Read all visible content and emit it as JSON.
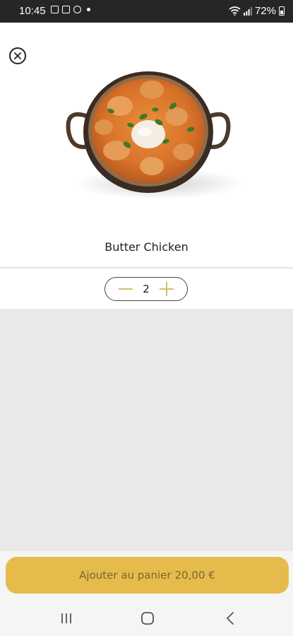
{
  "status_bar": {
    "time": "10:45",
    "battery": "72%"
  },
  "product": {
    "name": "Butter Chicken"
  },
  "quantity": {
    "value": "2"
  },
  "cart_button": {
    "label": "Ajouter au panier",
    "price": "20,00 €"
  },
  "colors": {
    "accent": "#e5bc4c",
    "accent_text": "#7a6530",
    "stepper_sign": "#d8bc73",
    "status_bar": "#262626",
    "empty_area": "#e9e9e9"
  },
  "icons": {
    "close": "close-icon",
    "minus": "minus-icon",
    "plus": "plus-icon",
    "nav_recent": "recent-apps-icon",
    "nav_home": "home-icon",
    "nav_back": "back-icon"
  }
}
